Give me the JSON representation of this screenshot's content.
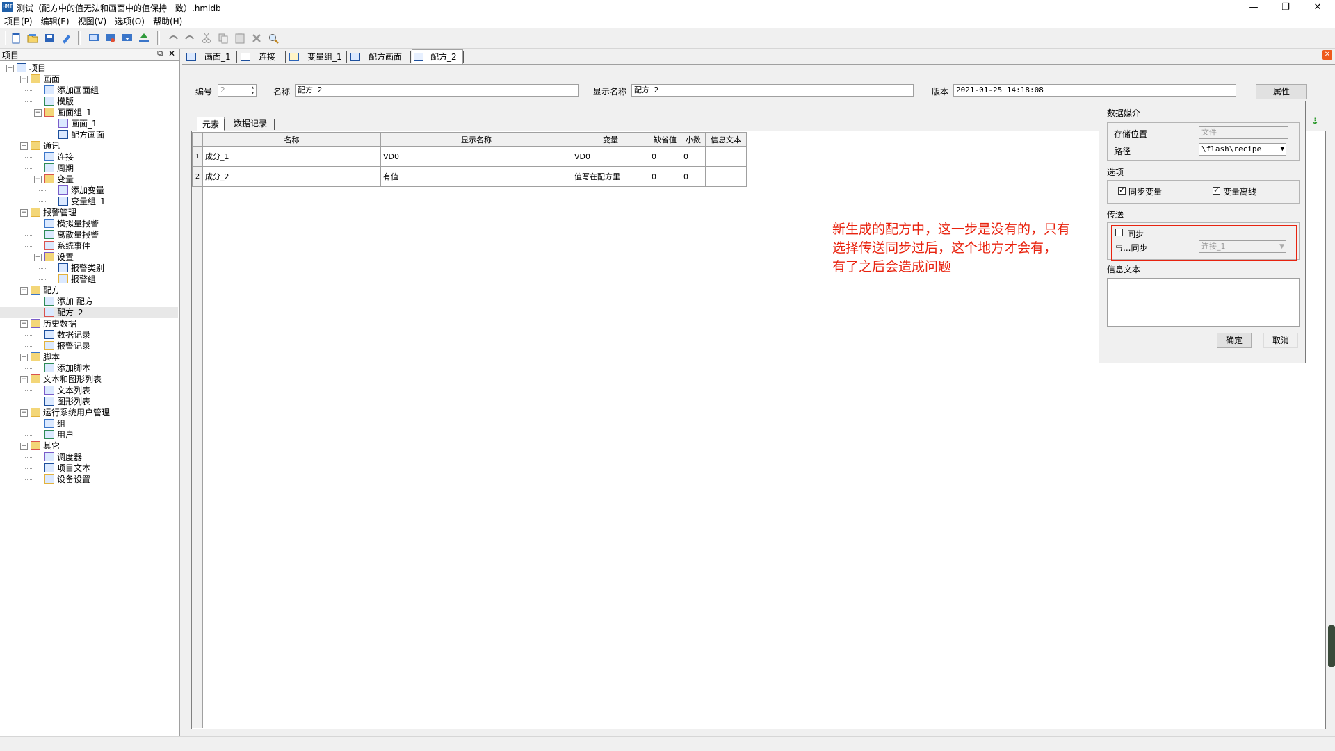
{
  "window": {
    "title": "测试（配方中的值无法和画面中的值保持一致）.hmidb",
    "app_icon_text": "HMI"
  },
  "menu": [
    "项目(P)",
    "编辑(E)",
    "视图(V)",
    "选项(O)",
    "帮助(H)"
  ],
  "left_panel": {
    "title": "项目",
    "tree": [
      {
        "label": "项目",
        "level": 0,
        "toggle": "−",
        "icon": "project-icon"
      },
      {
        "label": "画面",
        "level": 1,
        "toggle": "−",
        "icon": "screens-folder-icon"
      },
      {
        "label": "添加画面组",
        "level": 2,
        "toggle": "",
        "icon": "add-screen-group-icon"
      },
      {
        "label": "模版",
        "level": 2,
        "toggle": "",
        "icon": "template-icon"
      },
      {
        "label": "画面组_1",
        "level": 2,
        "toggle": "−",
        "icon": "screen-group-icon"
      },
      {
        "label": "画面_1",
        "level": 3,
        "toggle": "",
        "icon": "screen-icon"
      },
      {
        "label": "配方画面",
        "level": 3,
        "toggle": "",
        "icon": "screen-icon"
      },
      {
        "label": "通讯",
        "level": 1,
        "toggle": "−",
        "icon": "communication-folder-icon"
      },
      {
        "label": "连接",
        "level": 2,
        "toggle": "",
        "icon": "connection-icon"
      },
      {
        "label": "周期",
        "level": 2,
        "toggle": "",
        "icon": "cycle-icon"
      },
      {
        "label": "变量",
        "level": 2,
        "toggle": "−",
        "icon": "variable-folder-icon"
      },
      {
        "label": "添加变量",
        "level": 3,
        "toggle": "",
        "icon": "add-variable-icon"
      },
      {
        "label": "变量组_1",
        "level": 3,
        "toggle": "",
        "icon": "variable-group-icon"
      },
      {
        "label": "报警管理",
        "level": 1,
        "toggle": "−",
        "icon": "alarm-folder-icon"
      },
      {
        "label": "模拟量报警",
        "level": 2,
        "toggle": "",
        "icon": "analog-alarm-icon"
      },
      {
        "label": "离散量报警",
        "level": 2,
        "toggle": "",
        "icon": "discrete-alarm-icon"
      },
      {
        "label": "系统事件",
        "level": 2,
        "toggle": "",
        "icon": "system-event-icon"
      },
      {
        "label": "设置",
        "level": 2,
        "toggle": "−",
        "icon": "settings-icon"
      },
      {
        "label": "报警类别",
        "level": 3,
        "toggle": "",
        "icon": "alarm-class-icon"
      },
      {
        "label": "报警组",
        "level": 3,
        "toggle": "",
        "icon": "alarm-group-icon"
      },
      {
        "label": "配方",
        "level": 1,
        "toggle": "−",
        "icon": "recipe-folder-icon"
      },
      {
        "label": "添加 配方",
        "level": 2,
        "toggle": "",
        "icon": "add-recipe-icon"
      },
      {
        "label": "配方_2",
        "level": 2,
        "toggle": "",
        "icon": "recipe-icon",
        "selected": true
      },
      {
        "label": "历史数据",
        "level": 1,
        "toggle": "−",
        "icon": "history-folder-icon"
      },
      {
        "label": "数据记录",
        "level": 2,
        "toggle": "",
        "icon": "data-log-icon"
      },
      {
        "label": "报警记录",
        "level": 2,
        "toggle": "",
        "icon": "alarm-log-icon"
      },
      {
        "label": "脚本",
        "level": 1,
        "toggle": "−",
        "icon": "script-folder-icon"
      },
      {
        "label": "添加脚本",
        "level": 2,
        "toggle": "",
        "icon": "add-script-icon"
      },
      {
        "label": "文本和图形列表",
        "level": 1,
        "toggle": "−",
        "icon": "list-folder-icon"
      },
      {
        "label": "文本列表",
        "level": 2,
        "toggle": "",
        "icon": "text-list-icon"
      },
      {
        "label": "图形列表",
        "level": 2,
        "toggle": "",
        "icon": "graphic-list-icon"
      },
      {
        "label": "运行系统用户管理",
        "level": 1,
        "toggle": "−",
        "icon": "user-admin-folder-icon"
      },
      {
        "label": "组",
        "level": 2,
        "toggle": "",
        "icon": "group-icon"
      },
      {
        "label": "用户",
        "level": 2,
        "toggle": "",
        "icon": "user-icon"
      },
      {
        "label": "其它",
        "level": 1,
        "toggle": "−",
        "icon": "other-folder-icon"
      },
      {
        "label": "调度器",
        "level": 2,
        "toggle": "",
        "icon": "scheduler-icon"
      },
      {
        "label": "项目文本",
        "level": 2,
        "toggle": "",
        "icon": "project-text-icon"
      },
      {
        "label": "设备设置",
        "level": 2,
        "toggle": "",
        "icon": "device-settings-icon"
      }
    ]
  },
  "doc_tabs": [
    "画面_1",
    "连接",
    "变量组_1",
    "配方画面",
    "配方_2"
  ],
  "recipe": {
    "number_label": "编号",
    "number_value": "2",
    "name_label": "名称",
    "name_value": "配方_2",
    "display_name_label": "显示名称",
    "display_name_value": "配方_2",
    "version_label": "版本",
    "version_value": "2021-01-25 14:18:08",
    "properties_button": "属性"
  },
  "inner_tabs": [
    "元素",
    "数据记录"
  ],
  "grid": {
    "headers": [
      "名称",
      "显示名称",
      "变量",
      "缺省值",
      "小数",
      "信息文本"
    ],
    "rows": [
      {
        "no": "1",
        "cells": [
          "成分_1",
          "VD0",
          "VD0",
          "0",
          "0",
          ""
        ]
      },
      {
        "no": "2",
        "cells": [
          "成分_2",
          "有值",
          "值写在配方里",
          "0",
          "0",
          ""
        ]
      }
    ]
  },
  "dialog": {
    "data_medium_title": "数据媒介",
    "storage_label": "存储位置",
    "storage_value": "文件",
    "path_label": "路径",
    "path_value": "\\flash\\recipe",
    "options_title": "选项",
    "sync_var_label": "同步变量",
    "sync_var_checked": true,
    "var_offline_label": "变量离线",
    "var_offline_checked": true,
    "transfer_title": "传送",
    "sync_label": "同步",
    "sync_checked": false,
    "sync_with_label": "与...同步",
    "sync_with_value": "连接_1",
    "info_text_title": "信息文本",
    "ok_button": "确定",
    "cancel_button": "取消"
  },
  "annotation": {
    "lines": [
      "新生成的配方中，这一步是没有的，只有",
      "选择传送同步过后，这个地方才会有，",
      "有了之后会造成问题"
    ],
    "color": "#e8230f"
  }
}
